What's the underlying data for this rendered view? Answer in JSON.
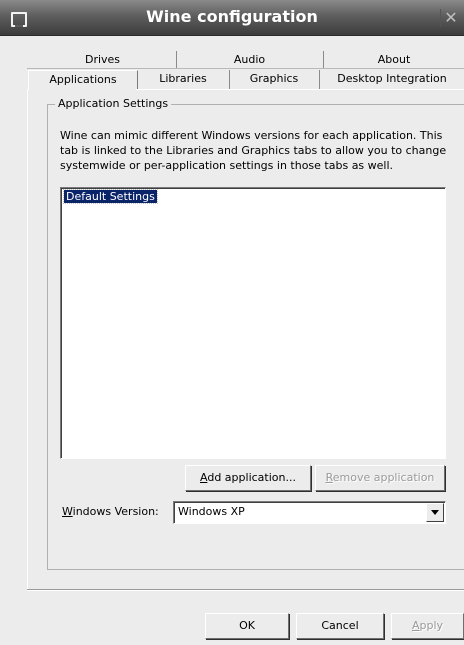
{
  "window": {
    "title": "Wine configuration",
    "close_symbol": "✕"
  },
  "tabs": {
    "back_row": [
      {
        "label": "Drives",
        "active": false
      },
      {
        "label": "Audio",
        "active": false
      },
      {
        "label": "About",
        "active": false
      }
    ],
    "front_row": [
      {
        "label": "Applications",
        "active": true
      },
      {
        "label": "Libraries",
        "active": false
      },
      {
        "label": "Graphics",
        "active": false
      },
      {
        "label": "Desktop Integration",
        "active": false
      }
    ]
  },
  "applications": {
    "group_title": "Application Settings",
    "description": "Wine can mimic different Windows versions for each application.  This tab is linked to the Libraries and Graphics tabs to allow you to change systemwide or per-application settings in those tabs as well.",
    "list_items": [
      {
        "label": "Default Settings",
        "selected": true
      }
    ],
    "add_button_pre": "",
    "add_button_mnemonic": "A",
    "add_button_post": "dd application...",
    "remove_button_mnemonic": "R",
    "remove_button_post": "emove application",
    "remove_enabled": false,
    "version_label_mnemonic": "W",
    "version_label_post": "indows Version:",
    "version_value": "Windows XP"
  },
  "footer": {
    "ok_label": "OK",
    "cancel_label": "Cancel",
    "apply_mnemonic": "A",
    "apply_post": "pply",
    "apply_enabled": false
  },
  "colors": {
    "titlebar_dark": "#3c3c3c",
    "dialog_bg": "#ececec",
    "selection_bg": "#0a246a",
    "selection_text": "#ffffff",
    "disabled_text": "#9a9a9a"
  },
  "icons": {
    "window_menu": "window-menu-icon",
    "close": "close-icon",
    "dropdown": "chevron-down-icon"
  }
}
